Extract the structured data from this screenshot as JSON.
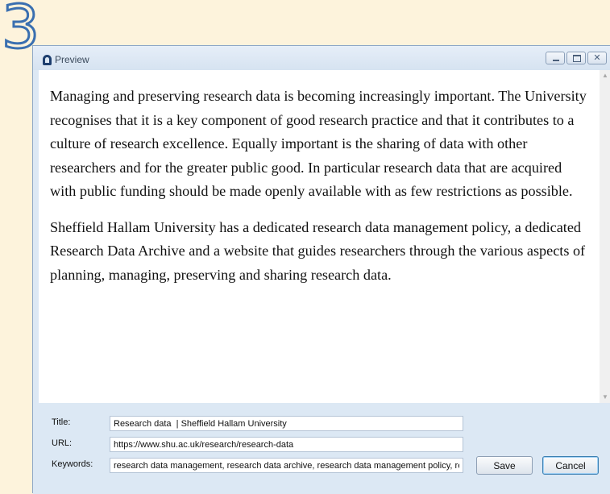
{
  "step_number": "3",
  "window": {
    "title": "Preview",
    "controls": {
      "minimize": "minimize",
      "maximize": "maximize",
      "close": "close"
    }
  },
  "content": {
    "paragraphs": [
      "Managing and preserving research data is becoming increasingly important. The University recognises that it is a key component of good research practice and that it contributes to a culture of research excellence. Equally important is the sharing of data with other researchers and for the greater public good. In particular research data that are acquired with public funding should be made openly available with as few restrictions as possible.",
      "Sheffield Hallam University has a dedicated research data management policy, a dedicated Research Data Archive and a website that guides researchers through the various aspects of planning, managing, preserving and sharing research data."
    ]
  },
  "form": {
    "title_label": "Title:",
    "title_value": "Research data  | Sheffield Hallam University",
    "url_label": "URL:",
    "url_value": "https://www.shu.ac.uk/research/research-data",
    "keywords_label": "Keywords:",
    "keywords_value": "research data management, research data archive, research data management policy, research data",
    "save_label": "Save",
    "cancel_label": "Cancel"
  },
  "colors": {
    "accent": "#3a6fb0",
    "window_frame": "#dce8f4",
    "background": "#fdf3dc"
  }
}
